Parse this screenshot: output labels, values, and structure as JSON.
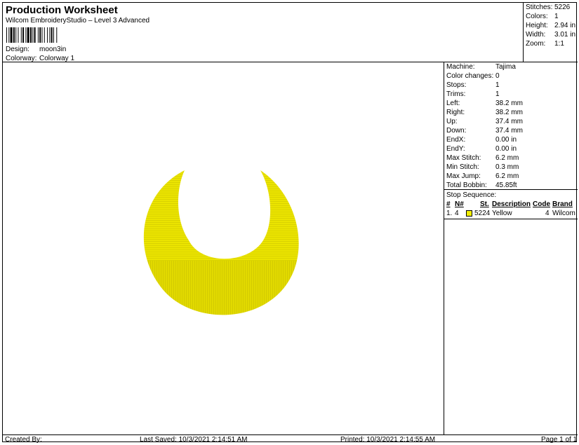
{
  "header": {
    "title": "Production Worksheet",
    "software": "Wilcom EmbroideryStudio – Level 3 Advanced",
    "design_label": "Design:",
    "design_value": "moon3in",
    "colorway_label": "Colorway:",
    "colorway_value": "Colorway 1"
  },
  "stats": [
    {
      "label": "Stitches:",
      "value": "5226"
    },
    {
      "label": "Colors:",
      "value": "1"
    },
    {
      "label": "Height:",
      "value": "2.94 in"
    },
    {
      "label": "Width:",
      "value": "3.01 in"
    },
    {
      "label": "Zoom:",
      "value": "1:1"
    }
  ],
  "machine_info": [
    {
      "label": "Machine:",
      "value": "Tajima"
    },
    {
      "label": "Color changes:",
      "value": "0"
    },
    {
      "label": "Stops:",
      "value": "1"
    },
    {
      "label": "Trims:",
      "value": "1"
    },
    {
      "label": "Left:",
      "value": "38.2 mm"
    },
    {
      "label": "Right:",
      "value": "38.2 mm"
    },
    {
      "label": "Up:",
      "value": "37.4 mm"
    },
    {
      "label": "Down:",
      "value": "37.4 mm"
    },
    {
      "label": "EndX:",
      "value": "0.00 in"
    },
    {
      "label": "EndY:",
      "value": "0.00 in"
    },
    {
      "label": "Max Stitch:",
      "value": "6.2 mm"
    },
    {
      "label": "Min Stitch:",
      "value": "0.3 mm"
    },
    {
      "label": "Max Jump:",
      "value": "6.2 mm"
    },
    {
      "label": "Total Bobbin:",
      "value": "45.85ft"
    }
  ],
  "stop_sequence": {
    "title": "Stop Sequence:",
    "columns": [
      "#",
      "N#",
      "St.",
      "Description",
      "Code",
      "Brand"
    ],
    "rows": [
      {
        "index": "1.",
        "needle": "4",
        "swatch_color": "#f2ee00",
        "stitches": "5224",
        "description": "Yellow",
        "code": "4",
        "brand": "Wilcom"
      }
    ]
  },
  "design_color": "#e8e400",
  "footer": {
    "created_by": "Created By:",
    "last_saved": "Last Saved: 10/3/2021 2:14:51 AM",
    "printed": "Printed: 10/3/2021 2:14:55 AM",
    "page": "Page 1 of 1"
  }
}
